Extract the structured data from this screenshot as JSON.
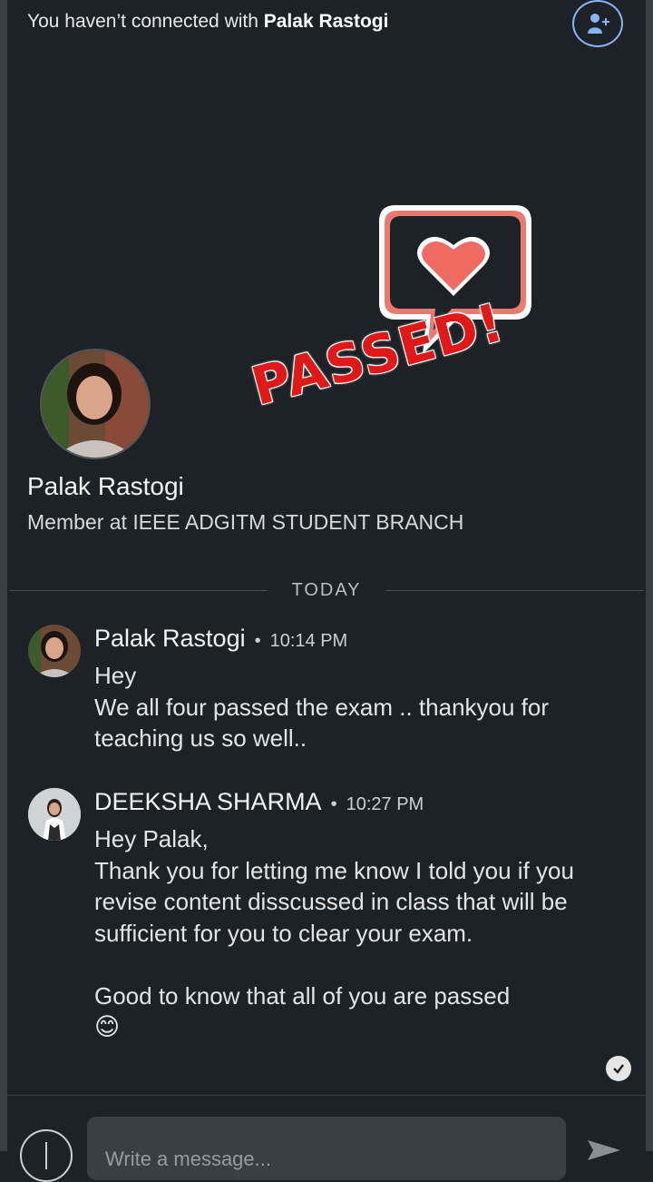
{
  "banner": {
    "prefix": "You haven’t connected with ",
    "name": "Palak Rastogi",
    "connect_icon": "add-person-icon"
  },
  "sticker": {
    "heart_color": "#f26b63",
    "stamp_text": "PASSED!",
    "stamp_color": "#e01818"
  },
  "profile": {
    "name": "Palak Rastogi",
    "headline": "Member at IEEE ADGITM STUDENT BRANCH"
  },
  "date_divider": "TODAY",
  "messages": [
    {
      "sender": "Palak Rastogi",
      "time": "10:14 PM",
      "lines": [
        "Hey",
        "We all four passed the exam .. thankyou for teaching us so well.."
      ]
    },
    {
      "sender": "DEEKSHA SHARMA",
      "time": "10:27 PM",
      "lines": [
        "Hey Palak,",
        "Thank you for letting me know I told you if you revise content disscussed in class that will be sufficient for you to clear your exam.",
        "",
        "Good to know that all of you are passed",
        "😊"
      ]
    }
  ],
  "composer": {
    "placeholder": "Write a message...",
    "attach_icon": "plus-icon",
    "send_icon": "send-icon"
  },
  "colors": {
    "background": "#1d2226",
    "accent": "#8ab4f8"
  }
}
